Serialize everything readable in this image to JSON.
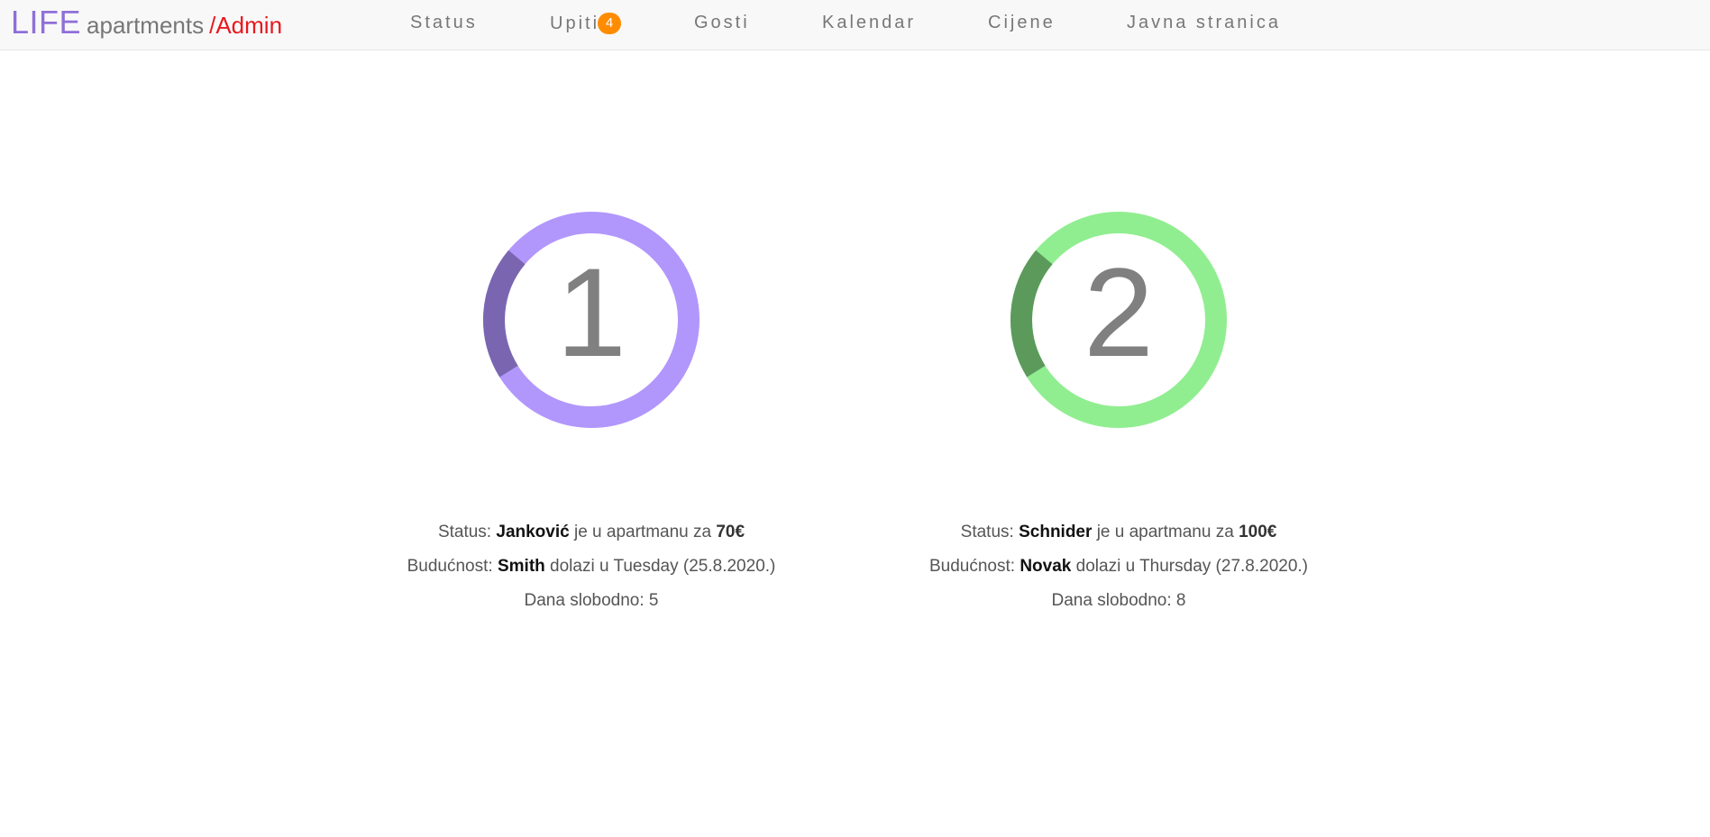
{
  "header": {
    "brand_life": "LIFE",
    "brand_apartments": "apartments",
    "brand_admin": "/Admin",
    "nav": {
      "status": "Status",
      "upiti": "Upiti",
      "upiti_badge": "4",
      "gosti": "Gosti",
      "kalendar": "Kalendar",
      "cijene": "Cijene",
      "javna": "Javna stranica"
    },
    "badge_color": "#ff8c00",
    "admin_color": "#e8181e",
    "brand_color": "#8f6fd9"
  },
  "apartments": [
    {
      "number": "1",
      "status_label": "Status:",
      "status_guest": "Janković",
      "status_text": "je u apartmanu za",
      "status_price": "70€",
      "future_label": "Budućnost:",
      "future_guest": "Smith",
      "future_text": "dolazi u Tuesday (25.8.2020.)",
      "free_text": "Dana slobodno: 5",
      "ring_color": "#b197fc",
      "ring_accent": "#7a66b0",
      "progress": 0.2
    },
    {
      "number": "2",
      "status_label": "Status:",
      "status_guest": "Schnider",
      "status_text": "je u apartmanu za",
      "status_price": "100€",
      "future_label": "Budućnost:",
      "future_guest": "Novak",
      "future_text": "dolazi u Thursday (27.8.2020.)",
      "free_text": "Dana slobodno: 8",
      "ring_color": "#90ee90",
      "ring_accent": "#5c9a5c",
      "progress": 0.2
    }
  ]
}
